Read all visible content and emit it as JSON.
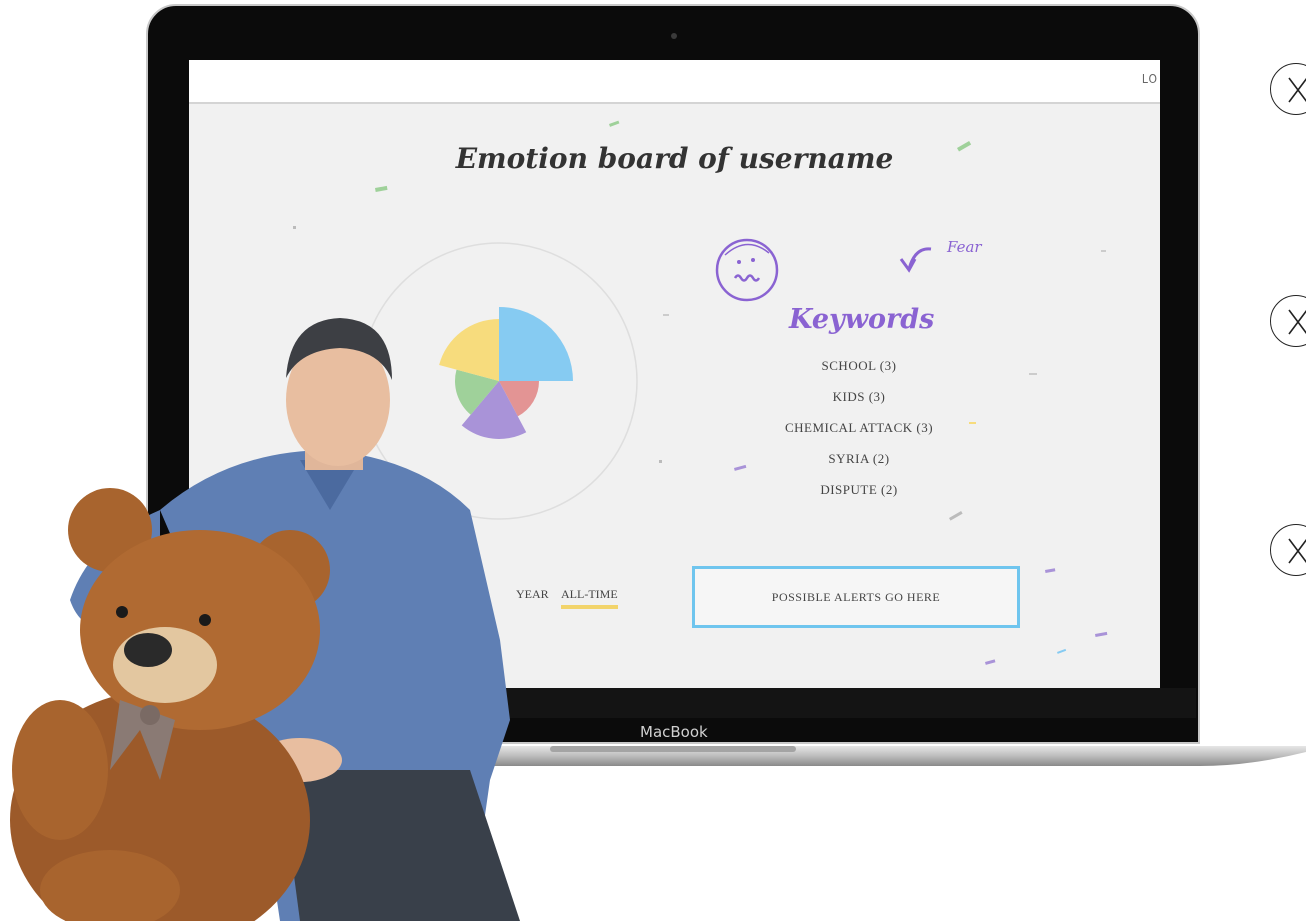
{
  "screen": {
    "topbar_text": "LO",
    "board_title": "Emotion board of username",
    "emotion_label": "Fear",
    "keywords_title": "Keywords",
    "keywords": [
      "SCHOOL (3)",
      "KIDS (3)",
      "CHEMICAL ATTACK (3)",
      "SYRIA (2)",
      "DISPUTE (2)"
    ],
    "time_filters": {
      "year": "YEAR",
      "all_time": "ALL-TIME",
      "active": "all_time"
    },
    "alerts_text": "POSSIBLE ALERTS GO HERE"
  },
  "laptop": {
    "label": "MacBook"
  },
  "icons": {
    "emotion_face": "worried-face-icon",
    "emotion_arrow": "curved-arrow-icon",
    "nav": [
      "close-circle-icon",
      "close-circle-icon",
      "close-circle-icon"
    ]
  },
  "colors": {
    "accent_purple": "#8a63d2",
    "alert_border": "#6fc5ee",
    "underline": "#f2d46b",
    "pie": [
      "#86cbf2",
      "#e39494",
      "#a993d8",
      "#9fd19a",
      "#f7dc7d"
    ]
  }
}
